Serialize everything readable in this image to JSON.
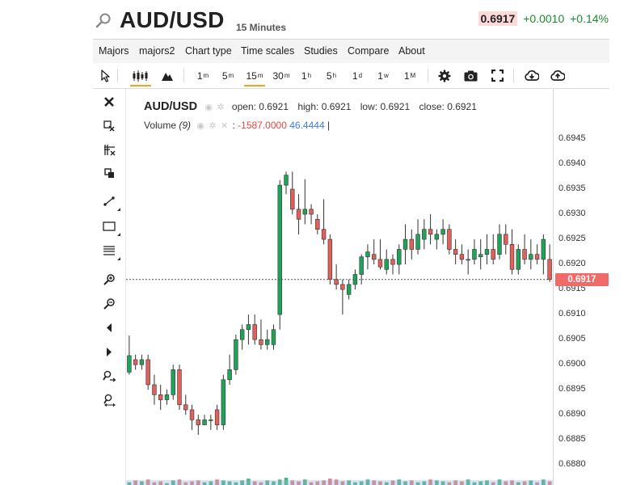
{
  "header": {
    "symbol": "AUD/USD",
    "interval": "15 Minutes",
    "last_price": "0.6917",
    "change": "+0.0010",
    "change_pct": "+0.14%"
  },
  "menu": [
    "Majors",
    "majors2",
    "Chart type",
    "Time scales",
    "Studies",
    "Compare",
    "About"
  ],
  "toolbar": {
    "timeframes": [
      {
        "label": "1",
        "unit": "m",
        "active": false
      },
      {
        "label": "5",
        "unit": "m",
        "active": false
      },
      {
        "label": "15",
        "unit": "m",
        "active": true
      },
      {
        "label": "30",
        "unit": "m",
        "active": false
      },
      {
        "label": "1",
        "unit": "h",
        "active": false
      },
      {
        "label": "5",
        "unit": "h",
        "active": false
      },
      {
        "label": "1",
        "unit": "d",
        "active": false
      },
      {
        "label": "1",
        "unit": "w",
        "active": false
      },
      {
        "label": "1",
        "unit": "M",
        "active": false
      }
    ]
  },
  "legend": {
    "symbol": "AUD/USD",
    "open_label": "open:",
    "open": "0.6921",
    "high_label": "high:",
    "high": "0.6921",
    "low_label": "low:",
    "low": "0.6921",
    "close_label": "close:",
    "close": "0.6921",
    "volume_label": "Volume",
    "volume_param": "(9)",
    "volume_sep": ":",
    "volume_value1": "-1587.0000",
    "volume_value2": "46.4444",
    "volume_end": "|"
  },
  "colors": {
    "up": "#1fa35b",
    "down": "#e0605a",
    "accent": "#f4a31c",
    "last_price_tag": "#f16a6a"
  },
  "chart_data": {
    "type": "candlestick",
    "y_ticks": [
      "0.6945",
      "0.6940",
      "0.6935",
      "0.6930",
      "0.6925",
      "0.6920",
      "0.6915",
      "0.6910",
      "0.6905",
      "0.6900",
      "0.6895",
      "0.6890",
      "0.6885",
      "0.6880"
    ],
    "ylim": [
      0.6876,
      0.6955
    ],
    "last_price": 0.6917,
    "last_price_label": "0.6917",
    "candles": [
      {
        "o": 0.68985,
        "h": 0.69058,
        "l": 0.6898,
        "c": 0.69018
      },
      {
        "o": 0.6901,
        "h": 0.6902,
        "l": 0.6899,
        "c": 0.69
      },
      {
        "o": 0.69,
        "h": 0.6902,
        "l": 0.6899,
        "c": 0.6901
      },
      {
        "o": 0.6901,
        "h": 0.6902,
        "l": 0.6895,
        "c": 0.6896
      },
      {
        "o": 0.6896,
        "h": 0.6898,
        "l": 0.6892,
        "c": 0.6894
      },
      {
        "o": 0.6894,
        "h": 0.6896,
        "l": 0.6891,
        "c": 0.6893
      },
      {
        "o": 0.6893,
        "h": 0.6895,
        "l": 0.6892,
        "c": 0.6894
      },
      {
        "o": 0.6894,
        "h": 0.69,
        "l": 0.6893,
        "c": 0.6899
      },
      {
        "o": 0.6899,
        "h": 0.69,
        "l": 0.6891,
        "c": 0.6892
      },
      {
        "o": 0.6892,
        "h": 0.6894,
        "l": 0.689,
        "c": 0.6891
      },
      {
        "o": 0.6891,
        "h": 0.6892,
        "l": 0.6887,
        "c": 0.6889
      },
      {
        "o": 0.6889,
        "h": 0.689,
        "l": 0.6886,
        "c": 0.6888
      },
      {
        "o": 0.6888,
        "h": 0.689,
        "l": 0.6888,
        "c": 0.6889
      },
      {
        "o": 0.6889,
        "h": 0.689,
        "l": 0.6887,
        "c": 0.6889
      },
      {
        "o": 0.6891,
        "h": 0.6892,
        "l": 0.6887,
        "c": 0.6888
      },
      {
        "o": 0.6888,
        "h": 0.6898,
        "l": 0.6887,
        "c": 0.6897
      },
      {
        "o": 0.6897,
        "h": 0.6902,
        "l": 0.6896,
        "c": 0.6899
      },
      {
        "o": 0.6899,
        "h": 0.6906,
        "l": 0.6898,
        "c": 0.6905
      },
      {
        "o": 0.6905,
        "h": 0.6908,
        "l": 0.6903,
        "c": 0.6907
      },
      {
        "o": 0.6907,
        "h": 0.691,
        "l": 0.6904,
        "c": 0.6908
      },
      {
        "o": 0.6908,
        "h": 0.691,
        "l": 0.6904,
        "c": 0.6905
      },
      {
        "o": 0.6905,
        "h": 0.6909,
        "l": 0.6903,
        "c": 0.6904
      },
      {
        "o": 0.6904,
        "h": 0.6907,
        "l": 0.6903,
        "c": 0.6905
      },
      {
        "o": 0.6904,
        "h": 0.6908,
        "l": 0.6903,
        "c": 0.6907
      },
      {
        "o": 0.691,
        "h": 0.69368,
        "l": 0.6907,
        "c": 0.69358
      },
      {
        "o": 0.69358,
        "h": 0.69385,
        "l": 0.6934,
        "c": 0.69378
      },
      {
        "o": 0.6935,
        "h": 0.69385,
        "l": 0.693,
        "c": 0.6931
      },
      {
        "o": 0.6931,
        "h": 0.6934,
        "l": 0.6926,
        "c": 0.6929
      },
      {
        "o": 0.693,
        "h": 0.6937,
        "l": 0.6928,
        "c": 0.6931
      },
      {
        "o": 0.6931,
        "h": 0.6932,
        "l": 0.6928,
        "c": 0.693
      },
      {
        "o": 0.6929,
        "h": 0.693,
        "l": 0.6926,
        "c": 0.6927
      },
      {
        "o": 0.6927,
        "h": 0.6933,
        "l": 0.6924,
        "c": 0.6925
      },
      {
        "o": 0.6925,
        "h": 0.6926,
        "l": 0.6916,
        "c": 0.6917
      },
      {
        "o": 0.6917,
        "h": 0.692,
        "l": 0.6915,
        "c": 0.6916
      },
      {
        "o": 0.6916,
        "h": 0.6917,
        "l": 0.691,
        "c": 0.6915
      },
      {
        "o": 0.6914,
        "h": 0.6917,
        "l": 0.6913,
        "c": 0.6916
      },
      {
        "o": 0.6916,
        "h": 0.6919,
        "l": 0.6915,
        "c": 0.6918
      },
      {
        "o": 0.6918,
        "h": 0.6922,
        "l": 0.6916,
        "c": 0.69215
      },
      {
        "o": 0.69215,
        "h": 0.6924,
        "l": 0.6919,
        "c": 0.69225
      },
      {
        "o": 0.6922,
        "h": 0.6925,
        "l": 0.692,
        "c": 0.6921
      },
      {
        "o": 0.6921,
        "h": 0.6925,
        "l": 0.6919,
        "c": 0.69195
      },
      {
        "o": 0.6919,
        "h": 0.6923,
        "l": 0.6918,
        "c": 0.6921
      },
      {
        "o": 0.6921,
        "h": 0.6922,
        "l": 0.6918,
        "c": 0.692
      },
      {
        "o": 0.692,
        "h": 0.6924,
        "l": 0.6918,
        "c": 0.6923
      },
      {
        "o": 0.6923,
        "h": 0.6928,
        "l": 0.692,
        "c": 0.6925
      },
      {
        "o": 0.6925,
        "h": 0.6927,
        "l": 0.6921,
        "c": 0.6923
      },
      {
        "o": 0.6923,
        "h": 0.6929,
        "l": 0.6922,
        "c": 0.6926
      },
      {
        "o": 0.6925,
        "h": 0.6929,
        "l": 0.6923,
        "c": 0.6927
      },
      {
        "o": 0.6927,
        "h": 0.693,
        "l": 0.6924,
        "c": 0.6926
      },
      {
        "o": 0.6925,
        "h": 0.6927,
        "l": 0.6923,
        "c": 0.6926
      },
      {
        "o": 0.6926,
        "h": 0.6929,
        "l": 0.6924,
        "c": 0.6927
      },
      {
        "o": 0.6927,
        "h": 0.6928,
        "l": 0.6922,
        "c": 0.6923
      },
      {
        "o": 0.6923,
        "h": 0.6925,
        "l": 0.692,
        "c": 0.6922
      },
      {
        "o": 0.6922,
        "h": 0.6924,
        "l": 0.692,
        "c": 0.6921
      },
      {
        "o": 0.6921,
        "h": 0.6923,
        "l": 0.6918,
        "c": 0.6921
      },
      {
        "o": 0.6921,
        "h": 0.6925,
        "l": 0.692,
        "c": 0.6923
      },
      {
        "o": 0.69215,
        "h": 0.6925,
        "l": 0.6919,
        "c": 0.6922
      },
      {
        "o": 0.6922,
        "h": 0.6926,
        "l": 0.692,
        "c": 0.6923
      },
      {
        "o": 0.6923,
        "h": 0.6926,
        "l": 0.692,
        "c": 0.6921
      },
      {
        "o": 0.6922,
        "h": 0.6928,
        "l": 0.6921,
        "c": 0.6926
      },
      {
        "o": 0.6926,
        "h": 0.6928,
        "l": 0.6922,
        "c": 0.6924
      },
      {
        "o": 0.6924,
        "h": 0.6927,
        "l": 0.6918,
        "c": 0.6919
      },
      {
        "o": 0.6919,
        "h": 0.6924,
        "l": 0.6918,
        "c": 0.6923
      },
      {
        "o": 0.6923,
        "h": 0.6926,
        "l": 0.692,
        "c": 0.6921
      },
      {
        "o": 0.6921,
        "h": 0.6925,
        "l": 0.6919,
        "c": 0.6922
      },
      {
        "o": 0.6922,
        "h": 0.6924,
        "l": 0.692,
        "c": 0.6921
      },
      {
        "o": 0.6921,
        "h": 0.6926,
        "l": 0.6918,
        "c": 0.6925
      },
      {
        "o": 0.6921,
        "h": 0.6924,
        "l": 0.69165,
        "c": 0.6917
      }
    ],
    "volume": [
      3,
      5,
      4,
      6,
      3,
      4,
      2,
      5,
      6,
      3,
      4,
      5,
      3,
      4,
      6,
      5,
      4,
      3,
      5,
      7,
      4,
      3,
      5,
      4,
      6,
      8,
      5,
      4,
      6,
      3,
      4,
      5,
      7,
      6,
      4,
      5,
      3,
      4,
      6,
      5,
      4,
      3,
      5,
      6,
      4,
      5,
      3,
      4,
      6,
      5,
      4,
      3,
      5,
      4,
      6,
      3,
      4,
      5,
      3,
      6,
      4,
      5,
      3,
      4,
      5,
      3,
      6,
      4
    ]
  }
}
